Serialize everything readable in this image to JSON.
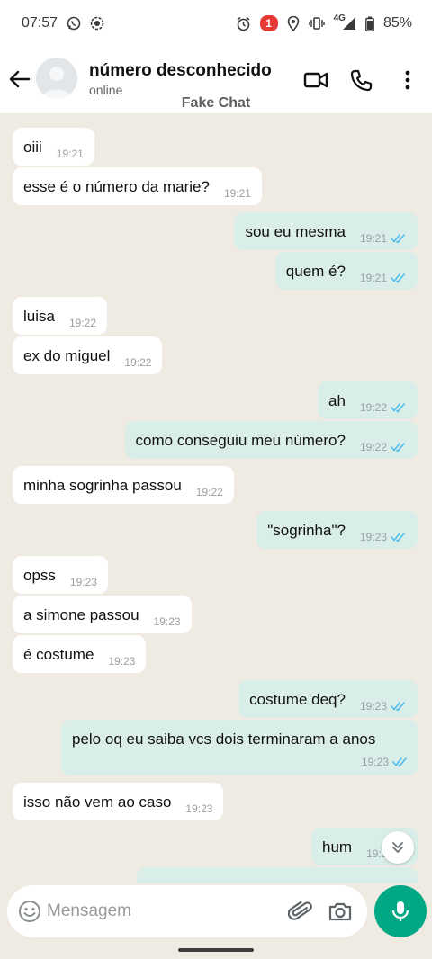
{
  "status_bar": {
    "time": "07:57",
    "notification_count": "1",
    "network": "4G",
    "battery": "85%"
  },
  "header": {
    "contact_name": "número desconhecido",
    "contact_status": "online",
    "watermark": "Fake Chat"
  },
  "messages": [
    {
      "dir": "in",
      "text": "oiii",
      "time": "19:21"
    },
    {
      "dir": "in",
      "text": "esse é o número da marie?",
      "time": "19:21"
    },
    {
      "dir": "out",
      "text": "sou eu mesma",
      "time": "19:21"
    },
    {
      "dir": "out",
      "text": "quem é?",
      "time": "19:21"
    },
    {
      "dir": "in",
      "text": "luisa",
      "time": "19:22"
    },
    {
      "dir": "in",
      "text": "ex do miguel",
      "time": "19:22"
    },
    {
      "dir": "out",
      "text": "ah",
      "time": "19:22"
    },
    {
      "dir": "out",
      "text": "como conseguiu meu número?",
      "time": "19:22"
    },
    {
      "dir": "in",
      "text": "minha sogrinha passou",
      "time": "19:22"
    },
    {
      "dir": "out",
      "text": "\"sogrinha\"?",
      "time": "19:23"
    },
    {
      "dir": "in",
      "text": "opss",
      "time": "19:23"
    },
    {
      "dir": "in",
      "text": "a simone passou",
      "time": "19:23"
    },
    {
      "dir": "in",
      "text": "é costume",
      "time": "19:23"
    },
    {
      "dir": "out",
      "text": "costume deq?",
      "time": "19:23"
    },
    {
      "dir": "out",
      "text": "pelo oq eu saiba vcs dois terminaram a anos",
      "time": "19:23"
    },
    {
      "dir": "in",
      "text": "isso não vem ao caso",
      "time": "19:23"
    },
    {
      "dir": "out",
      "text": "hum",
      "time": "19:2"
    }
  ],
  "input": {
    "placeholder": "Mensagem",
    "value": ""
  },
  "colors": {
    "chat_background": "#efeae2",
    "outgoing_bubble": "#d9eee9",
    "incoming_bubble": "#ffffff",
    "read_ticks": "#53bdeb",
    "accent": "#00a884"
  }
}
